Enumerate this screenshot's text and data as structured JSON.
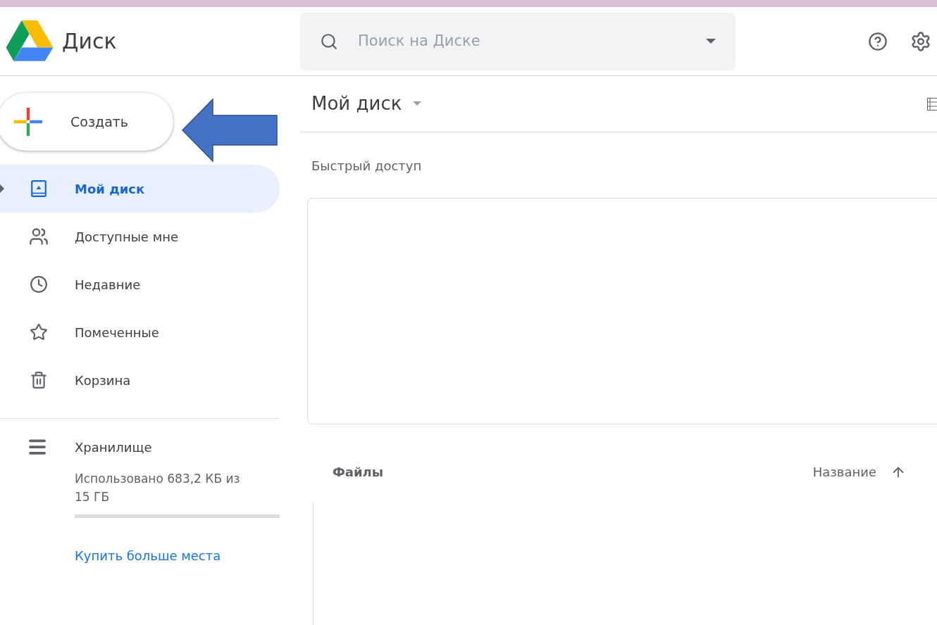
{
  "header": {
    "title": "Диск",
    "search": {
      "placeholder": "Поиск на Диске"
    }
  },
  "sidebar": {
    "create_button": "Создать",
    "items": [
      {
        "label": "Мой диск",
        "selected": true
      },
      {
        "label": "Доступные мне",
        "selected": false
      },
      {
        "label": "Недавние",
        "selected": false
      },
      {
        "label": "Помеченные",
        "selected": false
      },
      {
        "label": "Корзина",
        "selected": false
      }
    ],
    "storage": {
      "label": "Хранилище",
      "usage": "Использовано 683,2 КБ из 15 ГБ",
      "buy_link": "Купить больше места"
    }
  },
  "main": {
    "title": "Мой диск",
    "quick_access": "Быстрый доступ",
    "files_heading": "Файлы",
    "sort_label": "Название"
  }
}
